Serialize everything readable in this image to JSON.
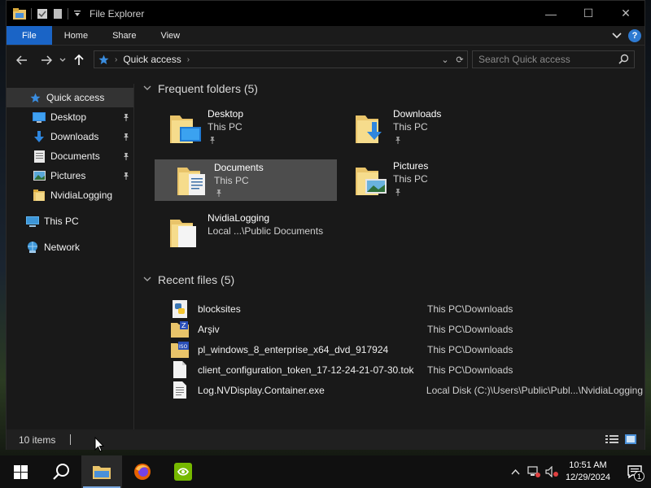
{
  "window": {
    "title": "File Explorer",
    "controls": {
      "minimize": "—",
      "maximize": "☐",
      "close": "✕"
    }
  },
  "ribbon": {
    "tabs": [
      {
        "label": "File"
      },
      {
        "label": "Home"
      },
      {
        "label": "Share"
      },
      {
        "label": "View"
      }
    ],
    "help": "?"
  },
  "address": {
    "path": "Quick access",
    "search_placeholder": "Search Quick access"
  },
  "sidebar": {
    "items": [
      {
        "label": "Quick access",
        "icon": "star-icon",
        "pinned": false
      },
      {
        "label": "Desktop",
        "icon": "desktop-icon",
        "pinned": true
      },
      {
        "label": "Downloads",
        "icon": "download-icon",
        "pinned": true
      },
      {
        "label": "Documents",
        "icon": "documents-icon",
        "pinned": true
      },
      {
        "label": "Pictures",
        "icon": "pictures-icon",
        "pinned": true
      },
      {
        "label": "NvidiaLogging",
        "icon": "folder-icon",
        "pinned": false
      },
      {
        "label": "This PC",
        "icon": "computer-icon",
        "pinned": false
      },
      {
        "label": "Network",
        "icon": "network-icon",
        "pinned": false
      }
    ]
  },
  "frequent": {
    "heading": "Frequent folders (5)",
    "folders": [
      {
        "name": "Desktop",
        "location": "This PC",
        "pinned": true
      },
      {
        "name": "Downloads",
        "location": "This PC",
        "pinned": true
      },
      {
        "name": "Documents",
        "location": "This PC",
        "pinned": true
      },
      {
        "name": "Pictures",
        "location": "This PC",
        "pinned": true
      },
      {
        "name": "NvidiaLogging",
        "location": "Local ...\\Public Documents",
        "pinned": false
      }
    ]
  },
  "recent": {
    "heading": "Recent files (5)",
    "files": [
      {
        "name": "blocksites",
        "path": "This PC\\Downloads",
        "icon": "python-file-icon"
      },
      {
        "name": "Arşiv",
        "path": "This PC\\Downloads",
        "icon": "zip-folder-icon"
      },
      {
        "name": "pl_windows_8_enterprise_x64_dvd_917924",
        "path": "This PC\\Downloads",
        "icon": "iso-file-icon"
      },
      {
        "name": "client_configuration_token_17-12-24-21-07-30.tok",
        "path": "This PC\\Downloads",
        "icon": "blank-file-icon"
      },
      {
        "name": "Log.NVDisplay.Container.exe",
        "path": "Local Disk (C:)\\Users\\Public\\Publ...\\NvidiaLogging",
        "icon": "text-file-icon"
      }
    ]
  },
  "status": {
    "items_count": "10 items"
  },
  "taskbar": {
    "time": "10:51 AM",
    "date": "12/29/2024",
    "notifications": "1"
  }
}
